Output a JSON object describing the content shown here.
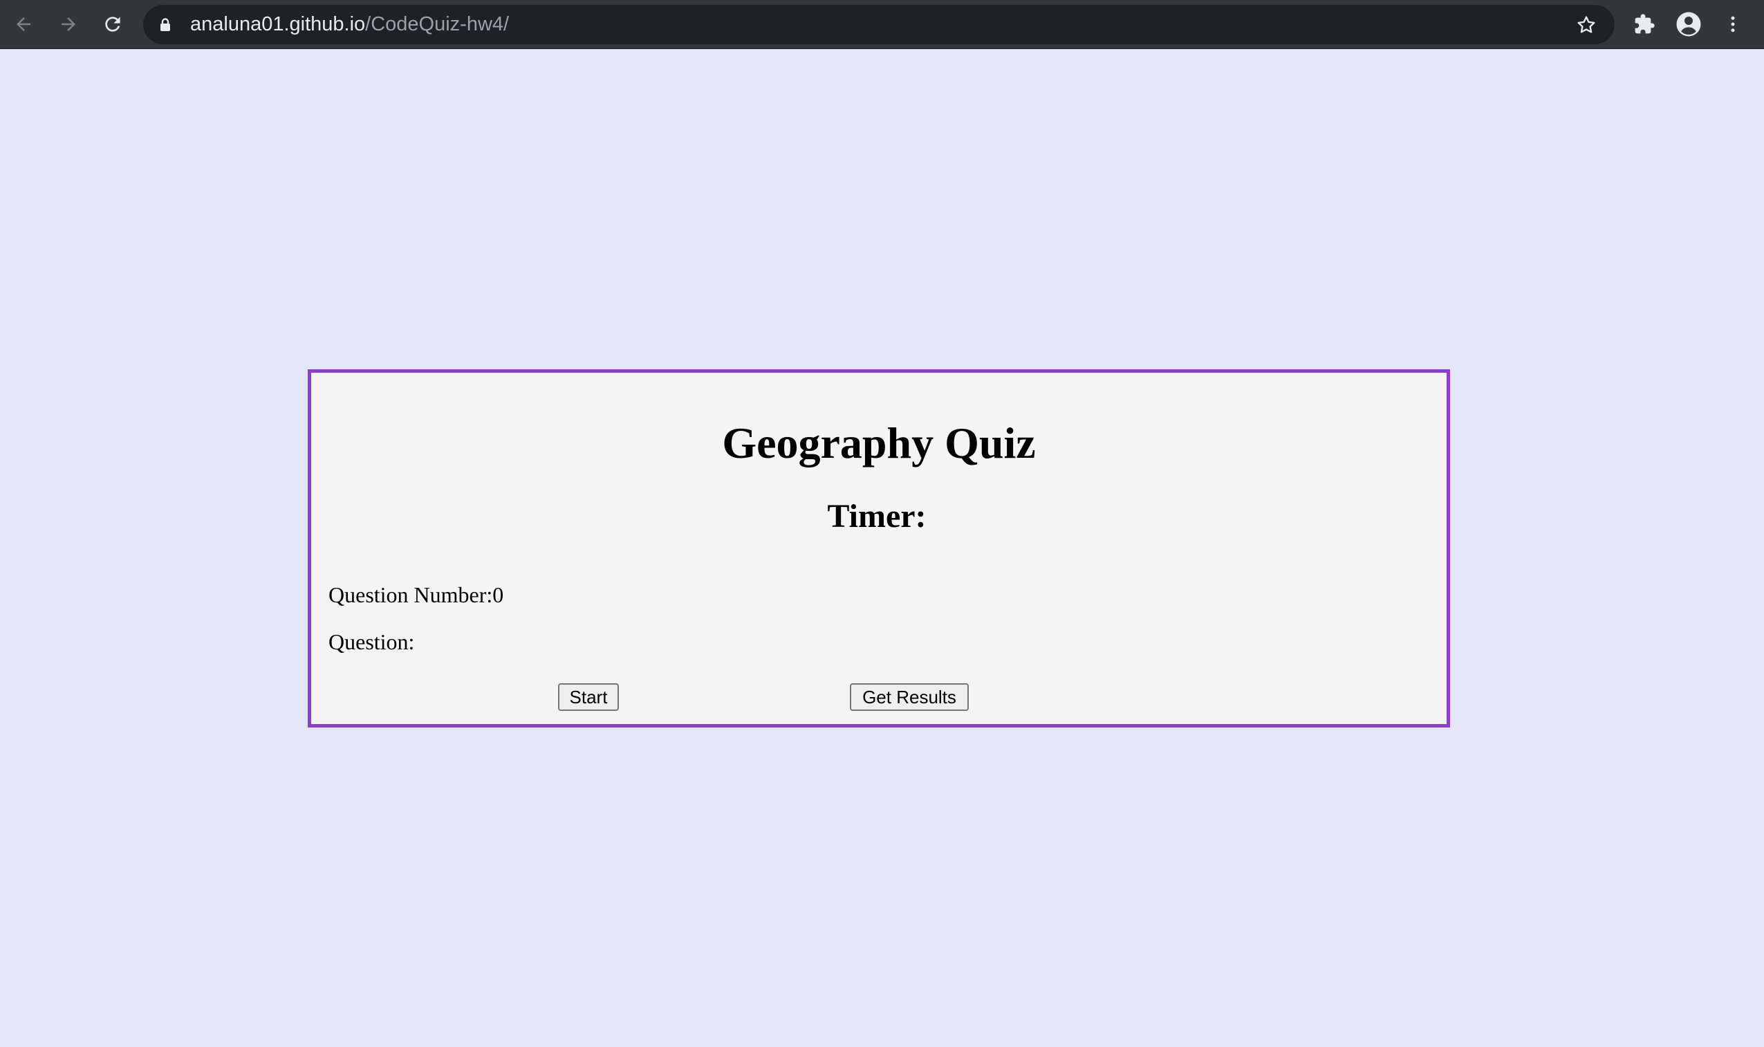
{
  "browser": {
    "url_host": "analuna01.github.io",
    "url_path": "/CodeQuiz-hw4/",
    "icons": [
      "back-arrow-icon",
      "forward-arrow-icon",
      "reload-icon",
      "lock-icon",
      "star-icon",
      "extensions-icon",
      "profile-icon",
      "menu-icon"
    ]
  },
  "quiz": {
    "title": "Geography Quiz",
    "timer_label": "Timer:",
    "timer_value": "",
    "question_number_label": "Question Number:",
    "question_number_value": "0",
    "question_label": "Question:",
    "question_text": "",
    "start_label": "Start",
    "results_label": "Get Results"
  },
  "colors": {
    "page_background": "#e6e6fa",
    "card_background": "#f4f4f4",
    "card_border": "#8a3fd1",
    "chrome_toolbar": "#35363a",
    "omnibox": "#202124"
  }
}
